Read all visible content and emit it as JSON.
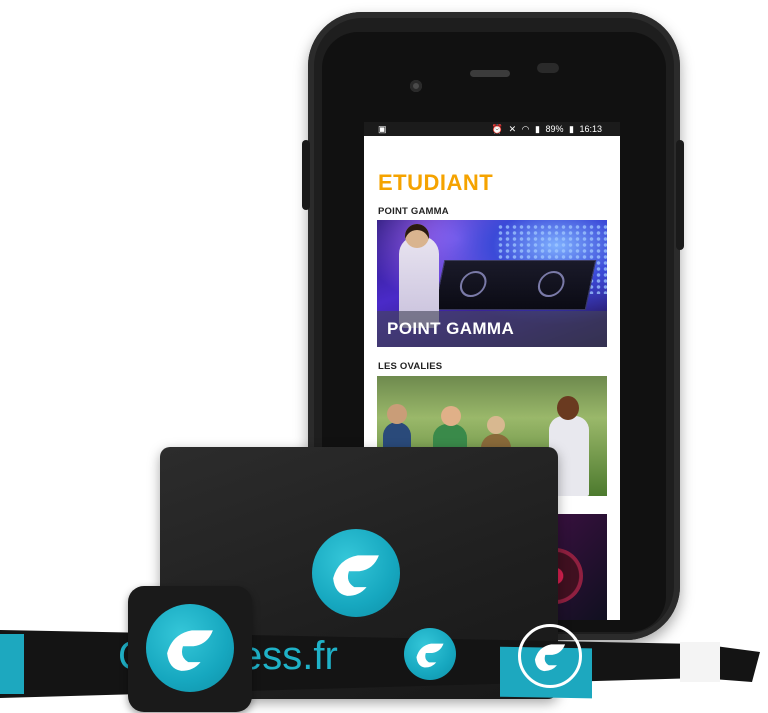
{
  "statusbar": {
    "left_icon": "image-notification-icon",
    "battery_percent": "89%",
    "time": "16:13",
    "icons": [
      "alarm-icon",
      "mute-icon",
      "wifi-icon",
      "signal-icon",
      "battery-icon"
    ]
  },
  "screen": {
    "title": "ETUDIANT",
    "sections": [
      {
        "label": "POINT GAMMA",
        "banner": "POINT GAMMA"
      },
      {
        "label": "LES OVALIES",
        "banner": ""
      }
    ]
  },
  "wristband": {
    "text_partial_prefix": "C",
    "text_visible": "ess.fr"
  },
  "colors": {
    "accent_orange": "#f5a300",
    "brand_teal": "#1fb2c8",
    "device_black": "#1e1e1e"
  }
}
